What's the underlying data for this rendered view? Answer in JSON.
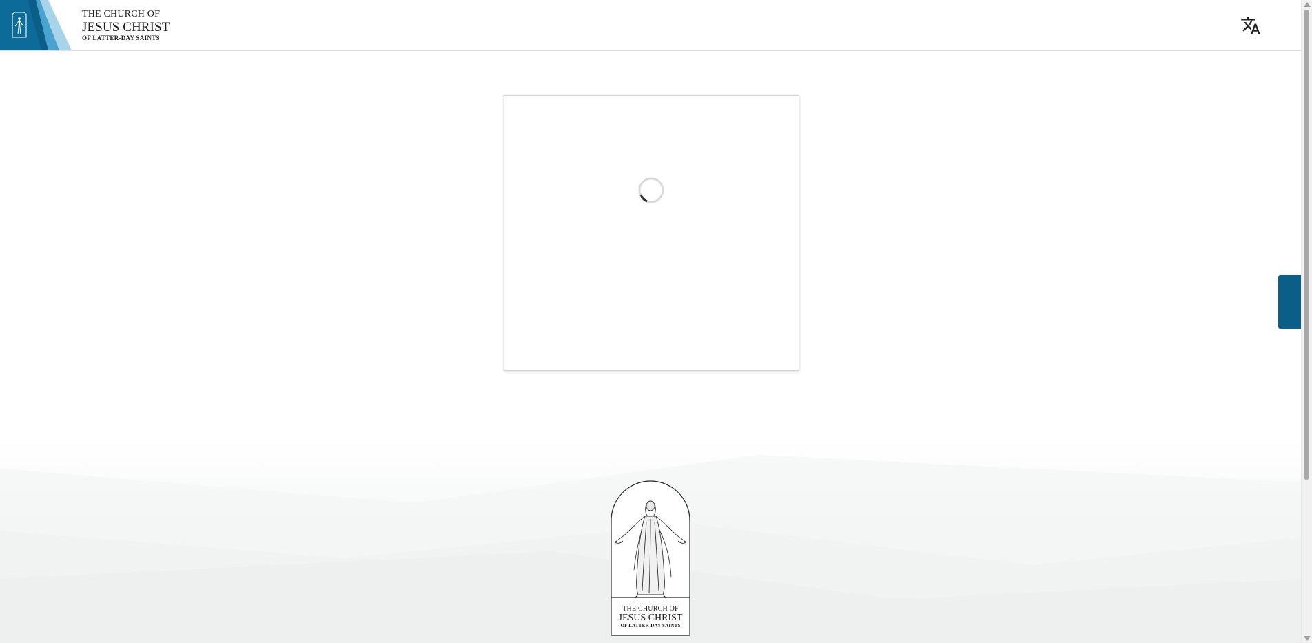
{
  "header": {
    "logo": {
      "line1": "THE CHURCH OF",
      "line2": "JESUS CHRIST",
      "line3": "OF LATTER-DAY SAINTS"
    },
    "translate_icon": "translate-icon"
  },
  "main": {
    "card": {
      "state": "loading",
      "spinner_icon": "loading-spinner-icon"
    },
    "side_tab_icon": "feedback-tab"
  },
  "footer": {
    "logo": {
      "line1": "THE CHURCH OF",
      "line2": "JESUS CHRIST",
      "line3": "OF LATTER-DAY SAINTS"
    },
    "emblem_icon": "christus-statue-icon"
  },
  "colors": {
    "brand_blue": "#0a5e88",
    "brand_light_blue": "#6fb3d6",
    "text_dark": "#1e1e1e"
  }
}
